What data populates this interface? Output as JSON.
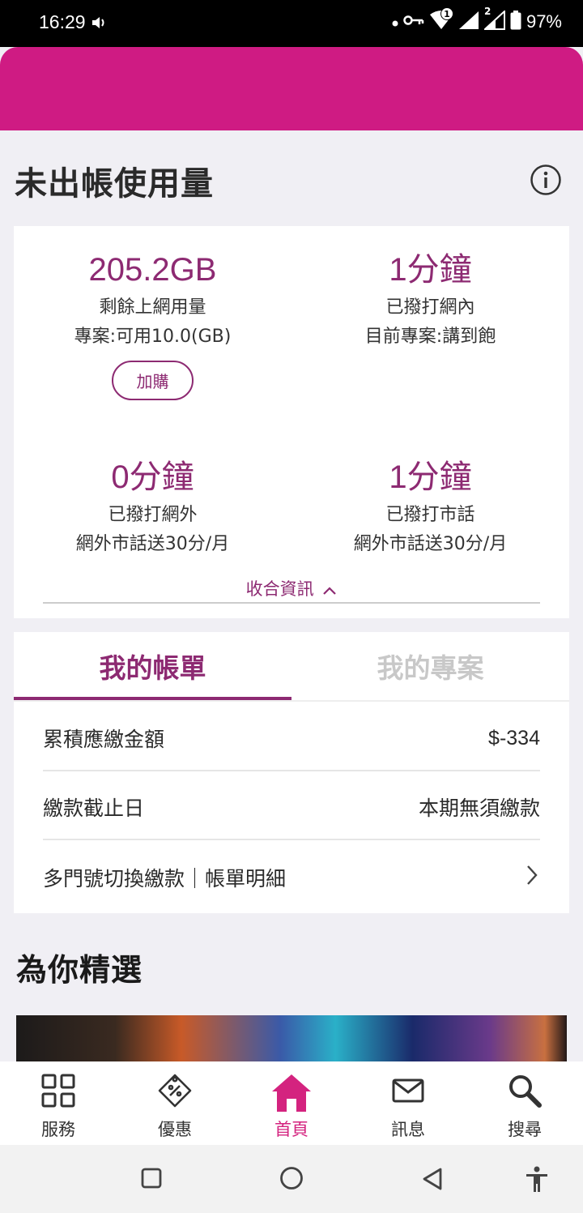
{
  "status_bar": {
    "time": "16:29",
    "sim1_badge": "1",
    "sim2_badge": "2",
    "battery": "97%"
  },
  "usage": {
    "title": "未出帳使用量",
    "items": [
      {
        "value": "205.2GB",
        "label": "剩餘上網用量",
        "detail": "專案:可用10.0(GB)"
      },
      {
        "value": "1分鐘",
        "label": "已撥打網內",
        "detail": "目前專案:講到飽"
      },
      {
        "value": "0分鐘",
        "label": "已撥打網外",
        "detail": "網外市話送30分/月"
      },
      {
        "value": "1分鐘",
        "label": "已撥打市話",
        "detail": "網外市話送30分/月"
      }
    ],
    "addon_label": "加購",
    "collapse_label": "收合資訊"
  },
  "billing": {
    "tabs": [
      {
        "label": "我的帳單",
        "active": true
      },
      {
        "label": "我的專案",
        "active": false
      }
    ],
    "rows": [
      {
        "label": "累積應繳金額",
        "value": "$-334"
      },
      {
        "label": "繳款截止日",
        "value": "本期無須繳款"
      }
    ],
    "link_label": "多門號切換繳款｜帳單明細"
  },
  "picks": {
    "title": "為你精選"
  },
  "bottom_nav": [
    {
      "label": "服務",
      "icon": "grid-icon",
      "active": false
    },
    {
      "label": "優惠",
      "icon": "coupon-icon",
      "active": false
    },
    {
      "label": "首頁",
      "icon": "home-icon",
      "active": true
    },
    {
      "label": "訊息",
      "icon": "mail-icon",
      "active": false
    },
    {
      "label": "搜尋",
      "icon": "search-icon",
      "active": false
    }
  ],
  "colors": {
    "brand_magenta": "#cf1b83",
    "accent_purple": "#8d2a72",
    "nav_active": "#d4237f",
    "inactive_tab": "#c8c8c8"
  }
}
